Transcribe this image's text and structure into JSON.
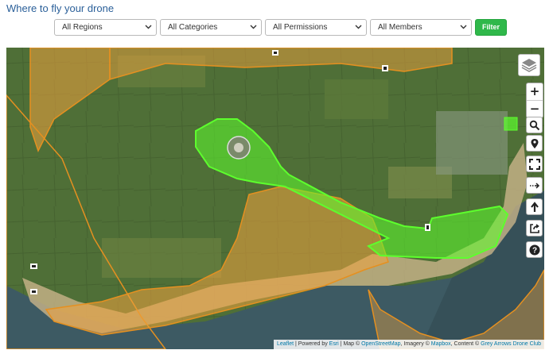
{
  "page": {
    "title": "Where to fly your drone"
  },
  "filters": {
    "regions": "All Regions",
    "categories": "All Categories",
    "permissions": "All Permissions",
    "members": "All Members",
    "filter_label": "Filter"
  },
  "map": {
    "zoom_in_label": "+",
    "zoom_out_label": "−",
    "zone_colors": {
      "permitted": "#5dff2d",
      "restricted": "#f0a23e",
      "restricted_outline": "#e59020"
    },
    "attribution": {
      "leaflet": "Leaflet",
      "sep1": " | Powered by ",
      "esri": "Esri",
      "sep2": " | Map © ",
      "osm": "OpenStreetMap",
      "sep3": ", Imagery © ",
      "mapbox": "Mapbox",
      "sep4": ", Content © ",
      "club": "Grey Arrows Drone Club"
    },
    "controls": [
      "layers-icon",
      "search-icon",
      "locate-icon",
      "fullscreen-icon",
      "route-icon",
      "upload-icon",
      "share-icon",
      "help-icon"
    ]
  }
}
